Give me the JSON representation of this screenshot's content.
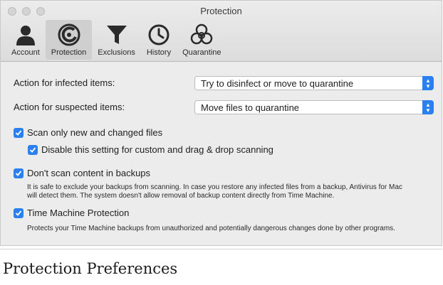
{
  "window": {
    "title": "Protection"
  },
  "tabs": [
    {
      "label": "Account",
      "icon": "person-icon"
    },
    {
      "label": "Protection",
      "icon": "shield-ring-icon",
      "active": true
    },
    {
      "label": "Exclusions",
      "icon": "funnel-icon"
    },
    {
      "label": "History",
      "icon": "clock-icon"
    },
    {
      "label": "Quarantine",
      "icon": "biohazard-icon"
    }
  ],
  "settings": {
    "infected": {
      "label": "Action for infected items:",
      "value": "Try to disinfect or move to quarantine"
    },
    "suspected": {
      "label": "Action for suspected items:",
      "value": "Move files to quarantine"
    },
    "scan_new": {
      "label": "Scan only new and changed files",
      "checked": true
    },
    "disable_custom": {
      "label": "Disable this setting for custom and drag & drop scanning",
      "checked": true
    },
    "backups": {
      "label": "Don't scan content in backups",
      "checked": true,
      "desc_line1": "It is safe to exclude your backups from scanning. In case you restore any infected files from a backup, Antivirus for Mac",
      "desc_line2": "will detect them. The system doesn't allow removal of backup content directly from Time Machine."
    },
    "time_machine": {
      "label": "Time Machine Protection",
      "checked": true,
      "desc": "Protects your Time Machine backups from unauthorized and potentially dangerous changes done by other programs."
    }
  },
  "page_heading": "Protection Preferences",
  "colors": {
    "accent": "#2b80f0",
    "window_bg": "#ececec"
  }
}
